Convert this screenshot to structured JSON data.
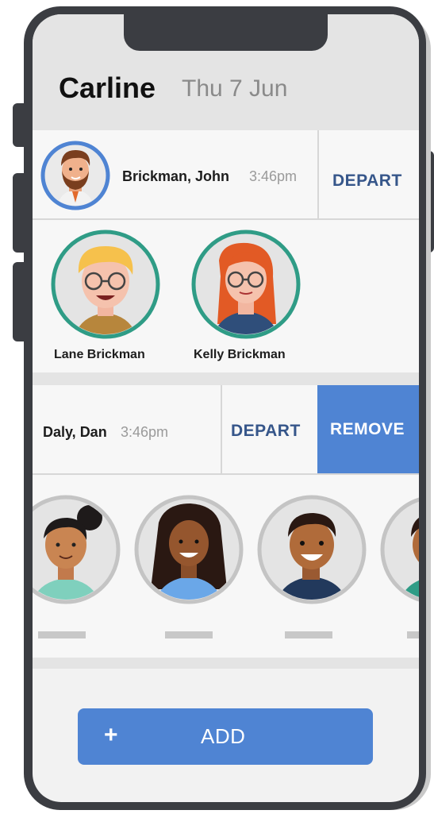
{
  "header": {
    "title": "Carline",
    "date": "Thu 7 Jun"
  },
  "pickups": [
    {
      "guardian_name": "Brickman, John",
      "time": "3:46pm",
      "depart_label": "DEPART",
      "students": [
        {
          "name": "Lane Brickman"
        },
        {
          "name": "Kelly Brickman"
        }
      ]
    },
    {
      "guardian_name": "Daly, Dan",
      "time": "3:46pm",
      "depart_label": "DEPART",
      "remove_label": "REMOVE",
      "students": [
        {
          "name": ""
        },
        {
          "name": ""
        },
        {
          "name": ""
        },
        {
          "name": ""
        }
      ]
    }
  ],
  "add_button": {
    "icon": "plus-icon",
    "label": "ADD"
  },
  "colors": {
    "accent": "#4f84d3",
    "depart_text": "#36568a",
    "avatar_ring_selected": "#2f9c86",
    "avatar_ring_guardian": "#4f84d3",
    "avatar_ring_default": "#c4c4c4"
  }
}
